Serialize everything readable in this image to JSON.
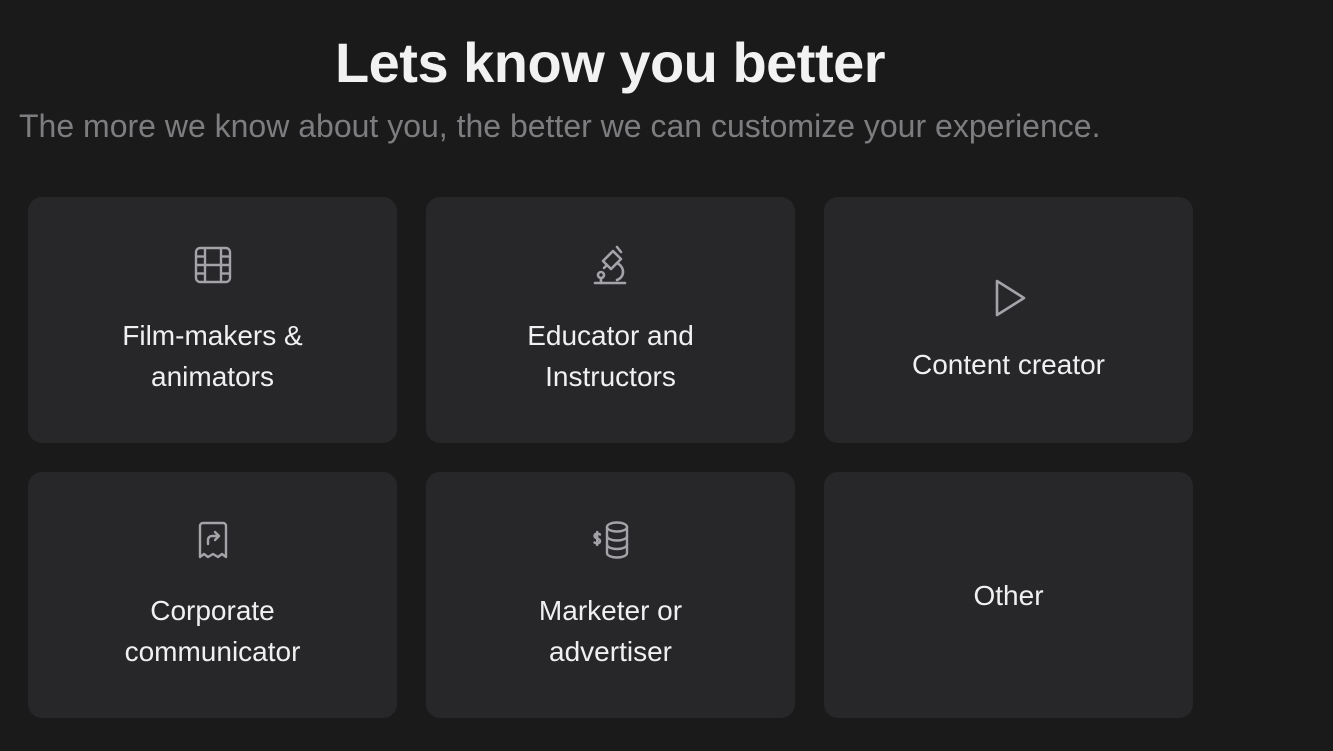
{
  "header": {
    "title": "Lets know you better",
    "subtitle": "The more we know about you, the better we can customize your experience."
  },
  "options": [
    {
      "label": "Film-makers & animators",
      "icon": "film-icon"
    },
    {
      "label": "Educator and Instructors",
      "icon": "microscope-icon"
    },
    {
      "label": "Content creator",
      "icon": "play-icon"
    },
    {
      "label": "Corporate communicator",
      "icon": "receipt-share-icon"
    },
    {
      "label": "Marketer or advertiser",
      "icon": "coins-dollar-icon"
    },
    {
      "label": "Other",
      "icon": ""
    }
  ],
  "colors": {
    "background": "#1a1a1b",
    "card": "#27272a",
    "title": "#f2f2f2",
    "subtitle": "#7d7d80",
    "icon": "#a3a3a8"
  }
}
